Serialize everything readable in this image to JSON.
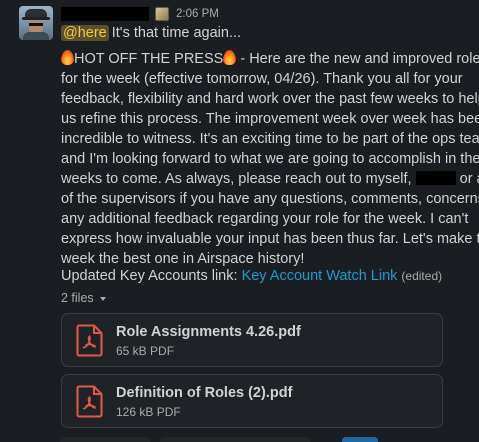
{
  "message": {
    "timestamp": "2:06 PM",
    "mention": "@here",
    "first_line_text": "It's that time again...",
    "body": {
      "line1_a": "HOT OFF THE PRESS",
      "line1_b": " -  Here are the new and improved roles",
      "line2": "for the week (effective tomorrow, 04/26).  Thank you all for your",
      "line3": "feedback, flexibility and hard work over the past few weeks to help",
      "line4": "us refine this process. The improvement week over week has been",
      "line5": "incredible to witness. It's an exciting time to be part of the ops team,",
      "line6": "and I'm looking forward to what we are going to accomplish in the",
      "line7_a": "weeks to come. As always, please reach out to myself,",
      "line7_b": "or any",
      "line8": "of the supervisors if you have any questions, comments, concerns or",
      "line9": "any additional feedback regarding your role for the week. I can't",
      "line10": "express how invaluable your input has been thus far. Let's make this",
      "line11": "week the best one in Airspace history!"
    },
    "link_prefix": "Updated Key Accounts link:",
    "link_text": "Key Account Watch Link",
    "edited_label": "(edited)",
    "files_label": "2 files",
    "files": [
      {
        "name": "Role Assignments 4.26.pdf",
        "meta": "65 kB PDF"
      },
      {
        "name": "Definition of Roles (2).pdf",
        "meta": "126 kB PDF"
      }
    ]
  },
  "colors": {
    "background": "#1a1d21",
    "text": "#d1d2d3",
    "muted": "#ababad",
    "link": "#1d9bd1",
    "mention_text": "#f2c744",
    "pdf_icon": "#e0584e"
  }
}
